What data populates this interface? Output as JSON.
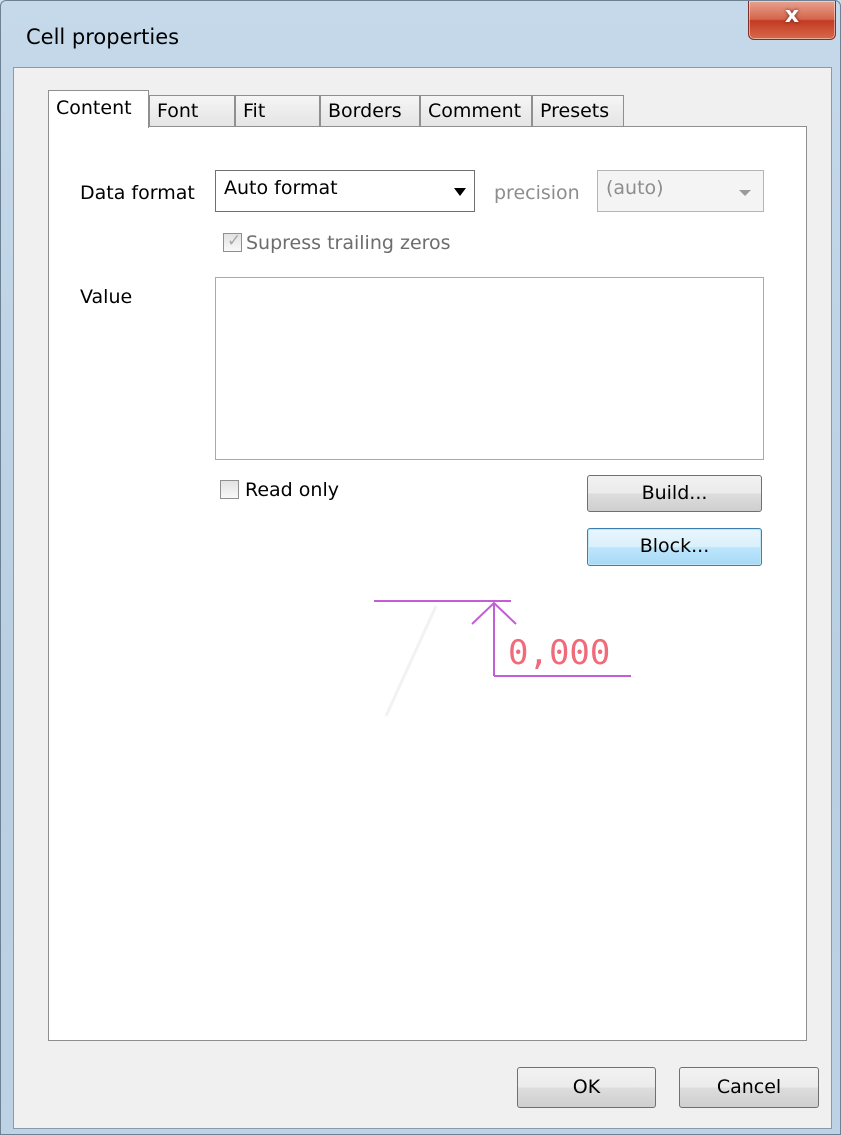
{
  "window": {
    "title": "Cell properties",
    "close_label": "x"
  },
  "tabs": [
    {
      "label": "Content",
      "active": true
    },
    {
      "label": "Font",
      "active": false
    },
    {
      "label": "Fit",
      "active": false
    },
    {
      "label": "Borders",
      "active": false
    },
    {
      "label": "Comment",
      "active": false
    },
    {
      "label": "Presets",
      "active": false
    }
  ],
  "content": {
    "data_format_label": "Data format",
    "data_format_value": "Auto format",
    "precision_label": "precision",
    "precision_value": "(auto)",
    "suppress_zeros_label": "Supress trailing zeros",
    "suppress_zeros_checked": true,
    "suppress_zeros_enabled": false,
    "value_label": "Value",
    "value_text": "",
    "read_only_label": "Read only",
    "read_only_checked": false,
    "build_button": "Build...",
    "block_button": "Block...",
    "preview_text": "0,000"
  },
  "footer": {
    "ok_button": "OK",
    "cancel_button": "Cancel"
  },
  "colors": {
    "preview_text": "#f06a7a",
    "preview_lines": "#c35ed6",
    "close_button": "#c8452c"
  }
}
